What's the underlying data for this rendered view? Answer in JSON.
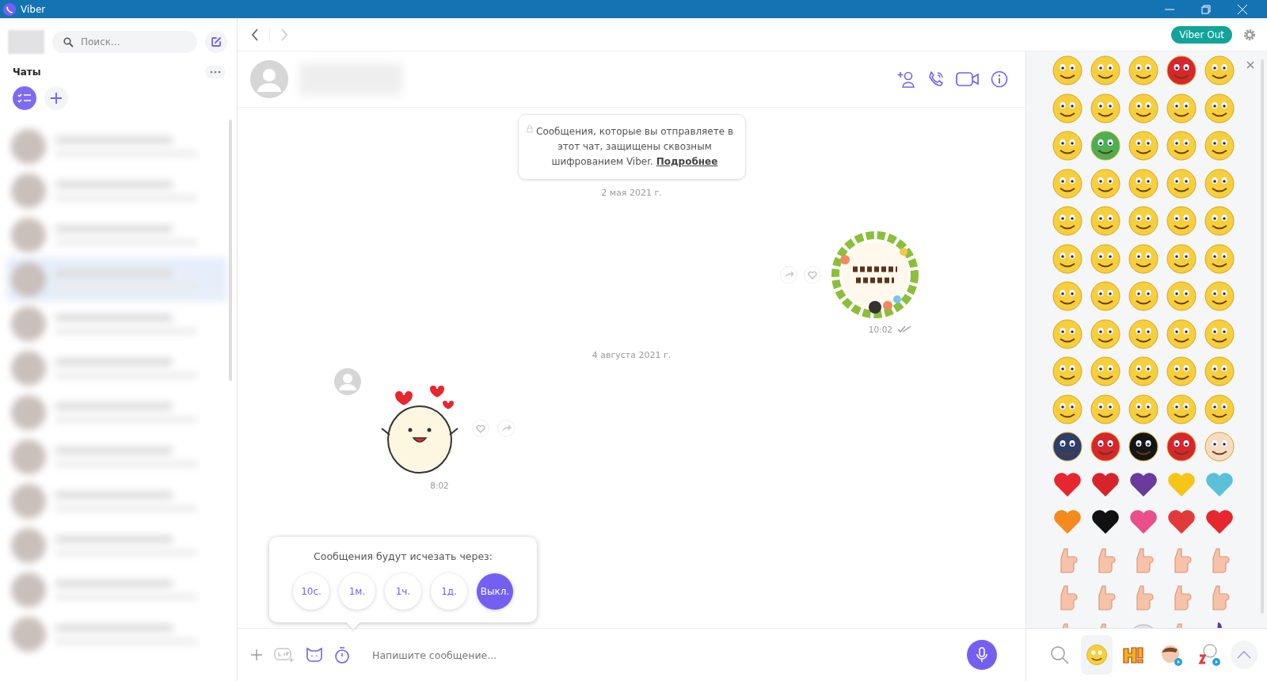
{
  "window": {
    "title": "Viber"
  },
  "sidebar": {
    "search": {
      "placeholder": "Поиск..."
    },
    "section_title": "Чаты",
    "filters": [
      {
        "kind": "list",
        "selected": true
      },
      {
        "kind": "add",
        "selected": false
      }
    ]
  },
  "toolbar": {
    "viber_out": "Viber Out"
  },
  "chat": {
    "encryption_notice": {
      "text": "Сообщения, которые вы отправляете в этот чат, защищены сквозным шифрованием Viber.",
      "link": "Подробнее"
    },
    "messages": [
      {
        "kind": "date",
        "text": "2 мая 2021 г."
      },
      {
        "kind": "outgoing_sticker",
        "time": "10:02",
        "read": true
      },
      {
        "kind": "date",
        "text": "4 августа 2021 г."
      },
      {
        "kind": "incoming_sticker",
        "time": "8:02"
      }
    ]
  },
  "chat_list": [
    {
      "selected": false
    },
    {
      "selected": false
    },
    {
      "selected": false
    },
    {
      "selected": true
    },
    {
      "selected": false
    },
    {
      "selected": false
    },
    {
      "selected": false
    },
    {
      "selected": false
    },
    {
      "selected": false
    },
    {
      "selected": false
    },
    {
      "selected": false
    },
    {
      "selected": false
    }
  ],
  "timer_popup": {
    "title": "Сообщения будут исчезать через:",
    "options": [
      {
        "label": "10с.",
        "selected": false
      },
      {
        "label": "1м.",
        "selected": false
      },
      {
        "label": "1ч.",
        "selected": false
      },
      {
        "label": "1д.",
        "selected": false
      },
      {
        "label": "Выкл.",
        "selected": true
      }
    ]
  },
  "composer": {
    "placeholder": "Напишите сообщение..."
  },
  "emoji_tabs": [
    {
      "kind": "search",
      "selected": false
    },
    {
      "kind": "smiley",
      "selected": true
    },
    {
      "kind": "hi",
      "selected": false
    },
    {
      "kind": "character",
      "selected": false
    },
    {
      "kind": "sheep",
      "selected": false
    }
  ]
}
